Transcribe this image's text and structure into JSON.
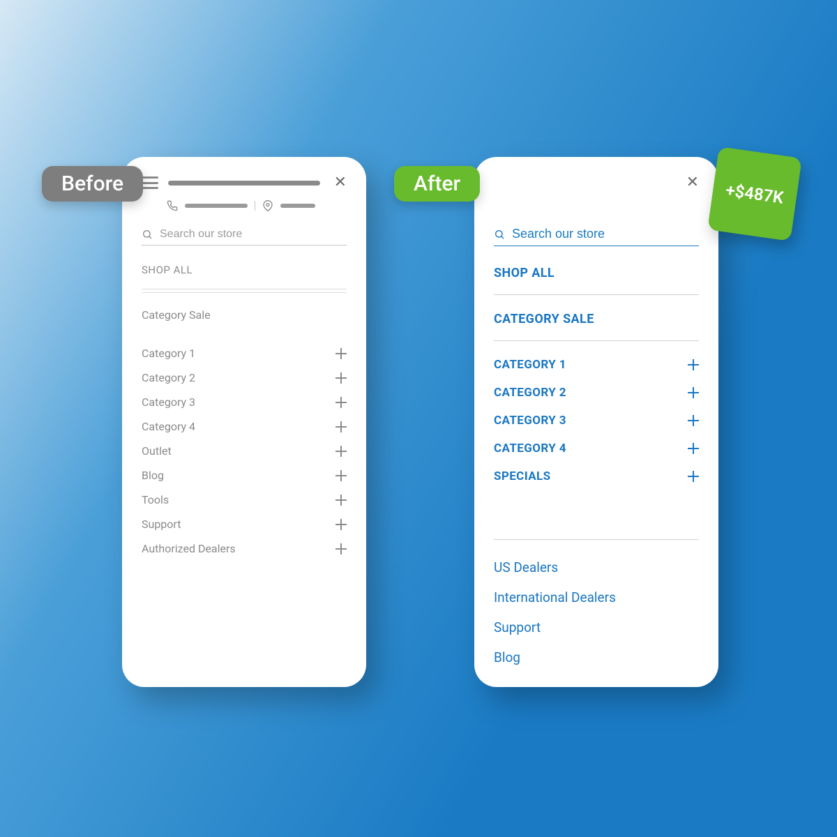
{
  "labels": {
    "before": "Before",
    "after": "After"
  },
  "price_badge": "+$487K",
  "before": {
    "search_placeholder": "Search our store",
    "shop_all": "SHOP ALL",
    "category_sale": "Category Sale",
    "items": [
      "Category 1",
      "Category 2",
      "Category 3",
      "Category 4",
      "Outlet",
      "Blog",
      "Tools",
      "Support",
      "Authorized Dealers"
    ]
  },
  "after": {
    "search_placeholder": "Search our store",
    "shop_all": "SHOP ALL",
    "category_sale": "CATEGORY SALE",
    "items": [
      "CATEGORY 1",
      "CATEGORY 2",
      "CATEGORY 3",
      "CATEGORY 4",
      "SPECIALS"
    ],
    "links": [
      "US Dealers",
      "International Dealers",
      "Support",
      "Blog"
    ]
  }
}
